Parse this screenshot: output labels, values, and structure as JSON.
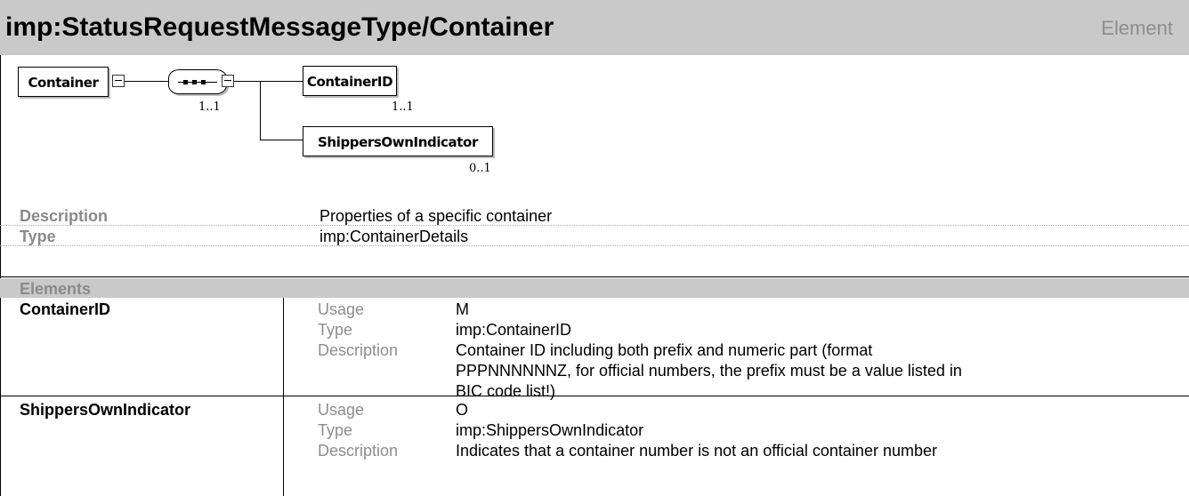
{
  "title": "imp:StatusRequestMessageType/Container",
  "title_kind": "Element",
  "diagram": {
    "root_label": "Container",
    "sequence_cardinality": "1..1",
    "children": [
      {
        "label": "ContainerID",
        "cardinality": "1..1"
      },
      {
        "label": "ShippersOwnIndicator",
        "cardinality": "0..1"
      }
    ]
  },
  "properties": {
    "description_label": "Description",
    "description_value": "Properties of a specific container",
    "type_label": "Type",
    "type_value": "imp:ContainerDetails"
  },
  "elements_header": "Elements",
  "elements": [
    {
      "name": "ContainerID",
      "usage_label": "Usage",
      "usage": "M",
      "type_label": "Type",
      "type": "imp:ContainerID",
      "description_label": "Description",
      "description_lines": [
        "Container ID including both prefix and numeric part (format",
        "PPPNNNNNNZ, for official numbers, the prefix must be a value listed in",
        "BIC code list!)"
      ]
    },
    {
      "name": "ShippersOwnIndicator",
      "usage_label": "Usage",
      "usage": "O",
      "type_label": "Type",
      "type": "imp:ShippersOwnIndicator",
      "description_label": "Description",
      "description_lines": [
        "Indicates that a container number is not an official container number"
      ]
    }
  ],
  "colors": {
    "header_bg": "#c9c9c9",
    "label_gray": "#8a8a8a"
  }
}
